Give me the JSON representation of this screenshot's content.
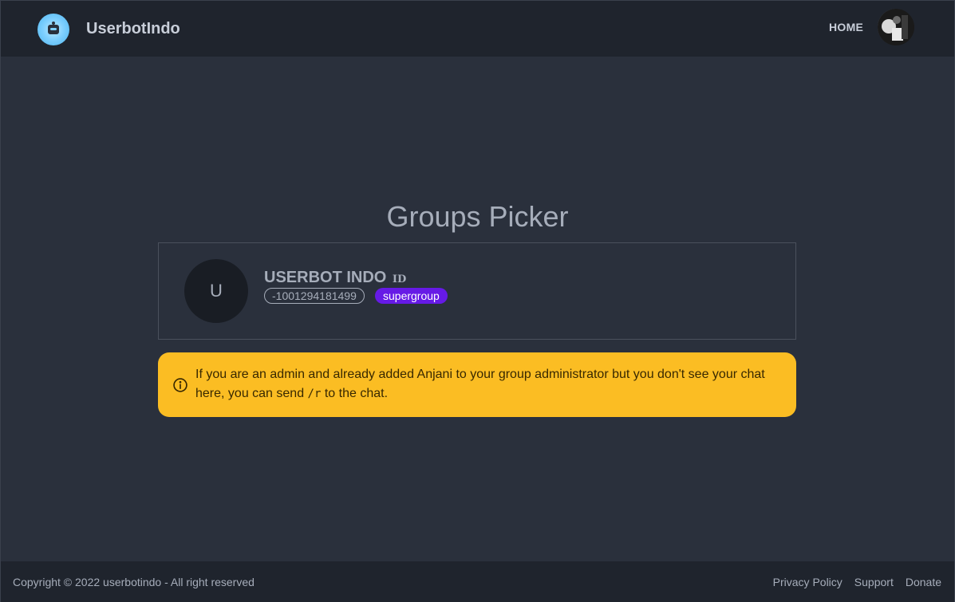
{
  "navbar": {
    "brand": "UserbotIndo",
    "home_label": "HOME",
    "logo_icon": "robot-icon",
    "avatar_icon": "user-avatar"
  },
  "main": {
    "title": "Groups Picker",
    "groups": [
      {
        "initial": "U",
        "name": "USERBOT INDO",
        "id_tag": "ID",
        "chat_id": "-1001294181499",
        "type": "supergroup"
      }
    ],
    "alert": {
      "icon": "info-icon",
      "text_before": "If you are an admin and already added Anjani to your group administrator but you don't see your chat here, you can send ",
      "command": "/r",
      "text_after": " to the chat."
    }
  },
  "footer": {
    "copyright": "Copyright © 2022 userbotindo - All right reserved",
    "links": [
      "Privacy Policy",
      "Support",
      "Donate"
    ]
  },
  "colors": {
    "background": "#2a303c",
    "navbar": "#1f242d",
    "alert": "#fbbd23",
    "badge": "#661ae6"
  }
}
